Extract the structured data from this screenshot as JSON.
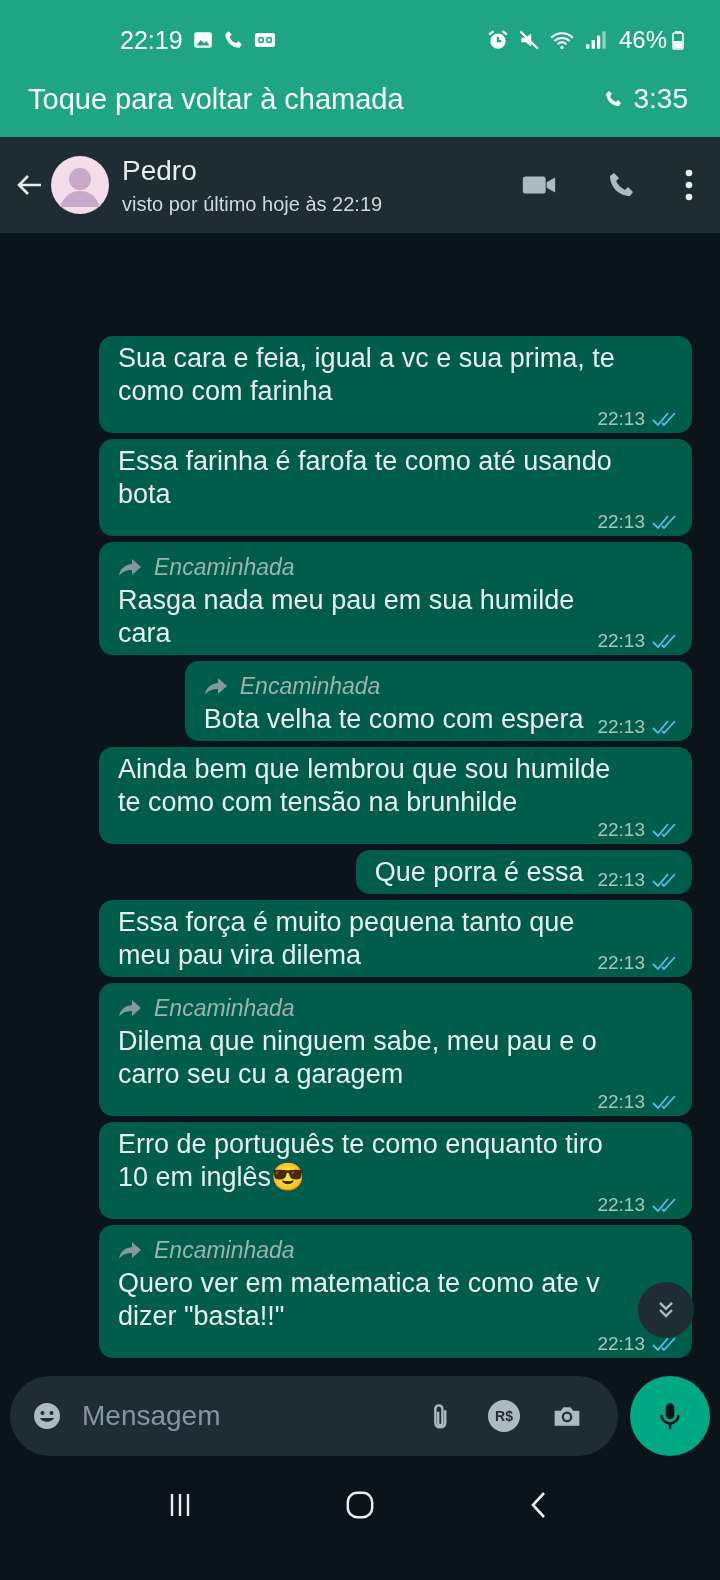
{
  "status_bar": {
    "time": "22:19",
    "battery": "46%"
  },
  "call_banner": {
    "label": "Toque para voltar à chamada",
    "duration": "3:35"
  },
  "contact": {
    "name": "Pedro",
    "last_seen": "visto por último hoje às 22:19"
  },
  "messages": [
    {
      "text": "Sua cara e feia, igual a vc e sua prima, te\ncomo com farinha",
      "time": "22:13",
      "read": true
    },
    {
      "text": "Essa farinha é farofa te como até usando\nbota",
      "time": "22:13",
      "read": true
    },
    {
      "forwarded_label": "Encaminhada",
      "text": "Rasga nada meu pau em sua humilde\ncara",
      "time": "22:13",
      "read": true
    },
    {
      "forwarded_label": "Encaminhada",
      "text": "Bota velha te como com espera",
      "time": "22:13",
      "read": true
    },
    {
      "text": "Ainda bem que lembrou que sou humilde\nte como com tensão na brunhilde",
      "time": "22:13",
      "read": true
    },
    {
      "text": "Que porra é essa",
      "time": "22:13",
      "read": true
    },
    {
      "text": "Essa força é muito pequena tanto que\nmeu pau vira dilema",
      "time": "22:13",
      "read": true
    },
    {
      "forwarded_label": "Encaminhada",
      "text": "Dilema que ninguem sabe, meu pau e o\ncarro seu cu a garagem",
      "time": "22:13",
      "read": true
    },
    {
      "text": "Erro de português te como enquanto tiro\n10 em inglês😎",
      "time": "22:13",
      "read": true
    },
    {
      "forwarded_label": "Encaminhada",
      "text": "Quero ver em matematica te como ate v\ndizer \"basta!!\"",
      "time": "22:13",
      "read": true
    }
  ],
  "composer": {
    "placeholder": "Mensagem",
    "payment_label": "R$"
  }
}
